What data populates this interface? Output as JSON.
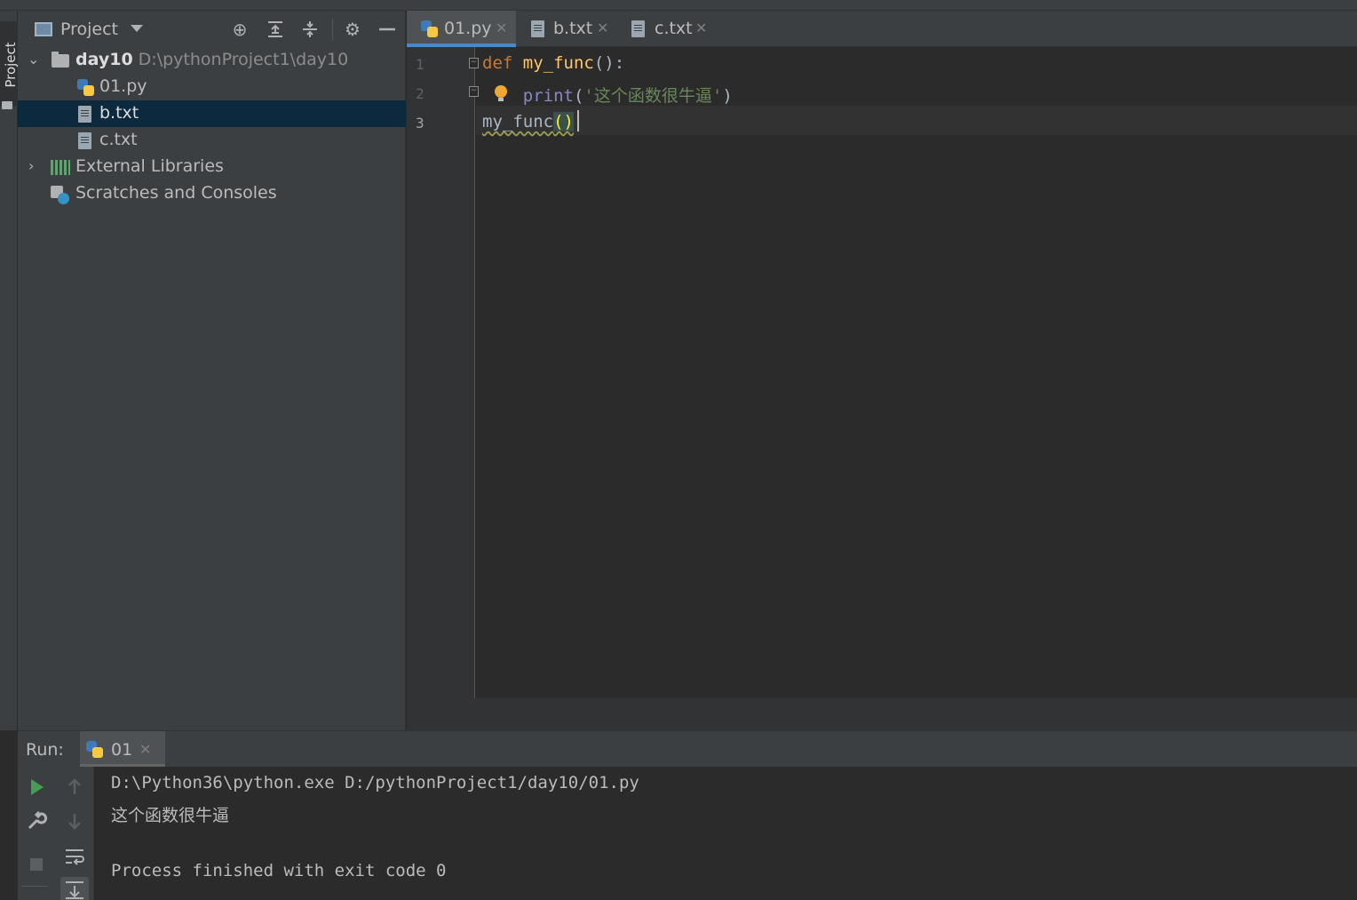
{
  "tool_stripe": {
    "project_label": "Project"
  },
  "project_panel": {
    "title": "Project",
    "header_icons": [
      "locate-icon",
      "expand-all-icon",
      "collapse-all-icon",
      "gear-icon",
      "minimize-icon"
    ],
    "tree": {
      "root": {
        "name": "day10",
        "path": "D:\\pythonProject1\\day10"
      },
      "files": [
        {
          "name": "01.py",
          "icon": "python-file-icon",
          "selected": false
        },
        {
          "name": "b.txt",
          "icon": "text-file-icon",
          "selected": true
        },
        {
          "name": "c.txt",
          "icon": "text-file-icon",
          "selected": false
        }
      ],
      "external_libraries": "External Libraries",
      "scratches": "Scratches and Consoles"
    }
  },
  "editor": {
    "tabs": [
      {
        "label": "01.py",
        "icon": "python-file-icon",
        "active": true
      },
      {
        "label": "b.txt",
        "icon": "text-file-icon",
        "active": false
      },
      {
        "label": "c.txt",
        "icon": "text-file-icon",
        "active": false
      }
    ],
    "line_numbers": [
      "1",
      "2",
      "3"
    ],
    "code": {
      "line1": {
        "keyword": "def",
        "name": "my_func",
        "rest": "():"
      },
      "line2": {
        "indent": "    ",
        "builtin": "print",
        "open": "(",
        "string": "'这个函数很牛逼'",
        "close": ")"
      },
      "line3": {
        "call": "my_func",
        "parens": "()"
      }
    },
    "current_line": 3
  },
  "run_panel": {
    "label": "Run:",
    "tab_label": "01",
    "console": [
      "D:\\Python36\\python.exe D:/pythonProject1/day10/01.py",
      "这个函数很牛逼",
      "",
      "Process finished with exit code 0"
    ]
  },
  "colors": {
    "keyword": "#cc7832",
    "function_name": "#ffc66d",
    "string": "#6a8759",
    "builtin": "#8888c6",
    "selection": "#0d293e",
    "active_tab_underline": "#4a88c7"
  }
}
